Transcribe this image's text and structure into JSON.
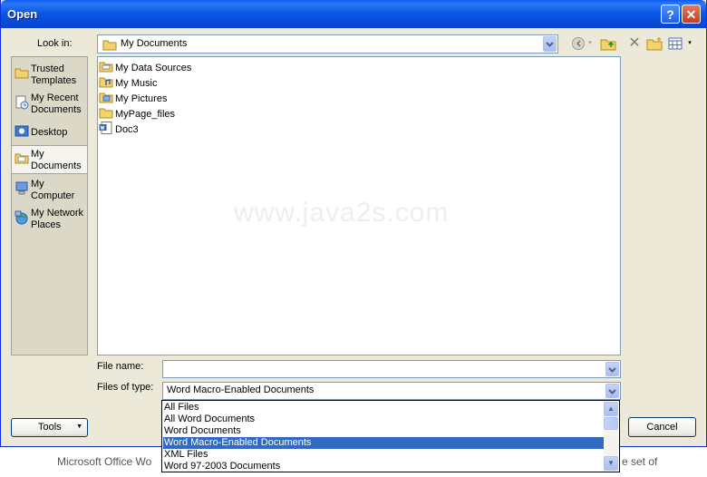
{
  "window": {
    "title": "Open",
    "help_glyph": "?",
    "close_glyph": "✕"
  },
  "lookin": {
    "label": "Look in:",
    "value": "My Documents"
  },
  "places": [
    {
      "label": "Trusted Templates",
      "icon": "folder-icon"
    },
    {
      "label": "My Recent Documents",
      "icon": "recent-documents-icon"
    },
    {
      "label": "Desktop",
      "icon": "desktop-icon"
    },
    {
      "label": "My Documents",
      "icon": "my-documents-icon",
      "selected": true
    },
    {
      "label": "My Computer",
      "icon": "my-computer-icon"
    },
    {
      "label": "My Network Places",
      "icon": "network-places-icon"
    }
  ],
  "files": [
    {
      "name": "My Data Sources",
      "icon": "folder-icon"
    },
    {
      "name": "My Music",
      "icon": "music-folder-icon"
    },
    {
      "name": "My Pictures",
      "icon": "pictures-folder-icon"
    },
    {
      "name": "MyPage_files",
      "icon": "folder-icon"
    },
    {
      "name": "Doc3",
      "icon": "word-document-icon"
    }
  ],
  "watermark": "www.java2s.com",
  "filename": {
    "label": "File name:",
    "value": ""
  },
  "filetype": {
    "label": "Files of type:",
    "value": "Word Macro-Enabled Documents",
    "options": [
      "All Files",
      "All Word Documents",
      "Word Documents",
      "Word Macro-Enabled Documents",
      "XML Files",
      "Word 97-2003 Documents"
    ],
    "selected_index": 3
  },
  "buttons": {
    "tools": "Tools",
    "cancel": "Cancel"
  },
  "background_text": {
    "left": "Microsoft Office Wo",
    "right": "e set of"
  },
  "colors": {
    "titlebar": "#0a55e0",
    "selection": "#316ac5",
    "dialog": "#ece9d8"
  }
}
